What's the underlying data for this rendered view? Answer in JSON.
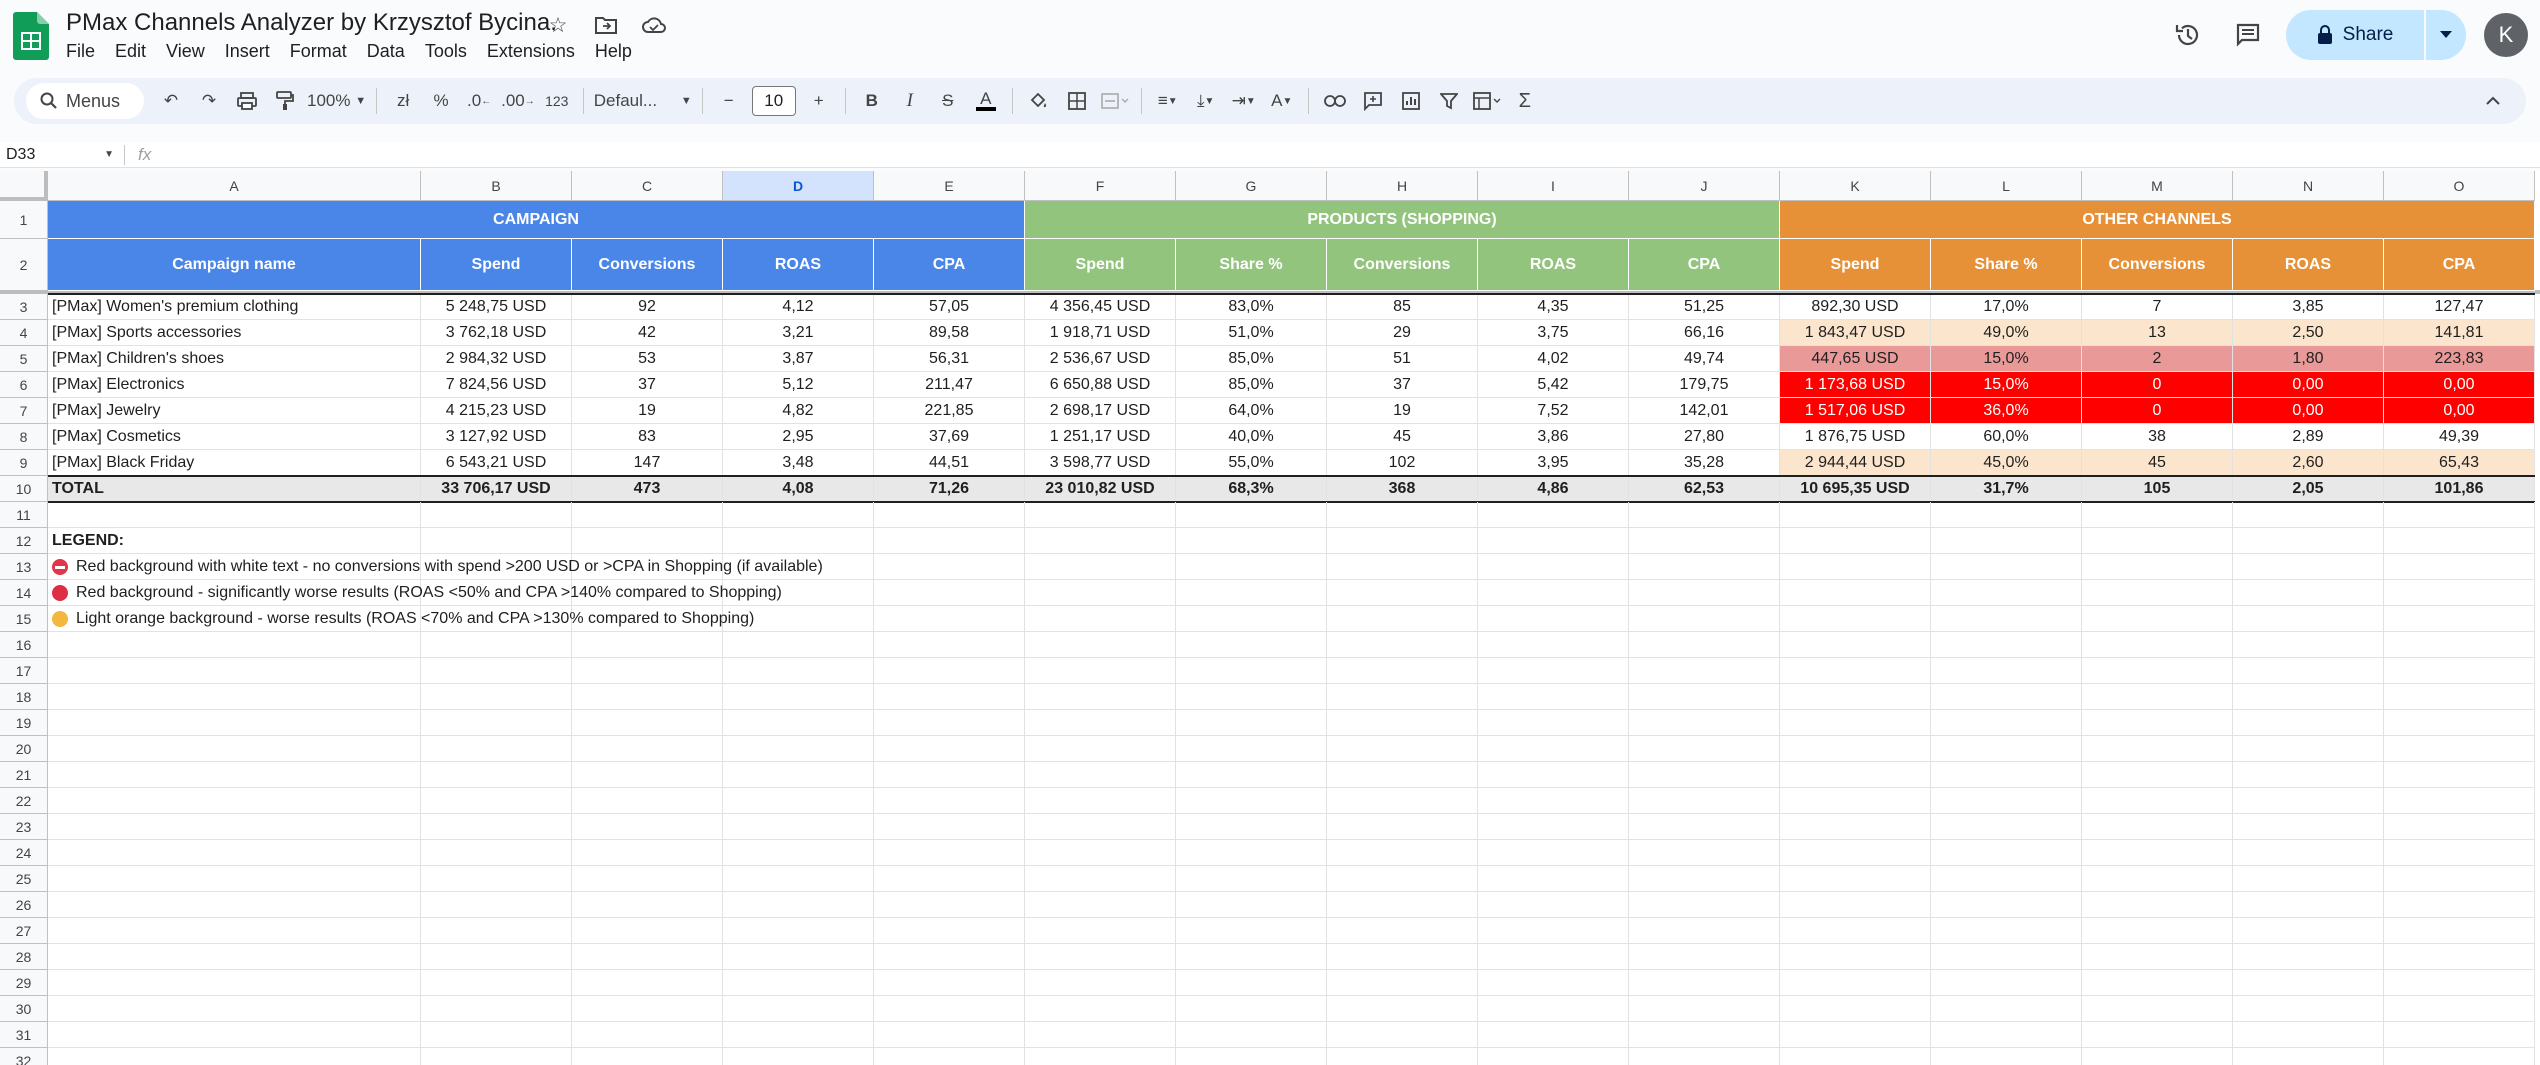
{
  "app": {
    "doc_title": "PMax Channels Analyzer by Krzysztof Bycina.",
    "menus": [
      "File",
      "Edit",
      "View",
      "Insert",
      "Format",
      "Data",
      "Tools",
      "Extensions",
      "Help"
    ],
    "share_label": "Share",
    "avatar_letter": "K"
  },
  "toolbar": {
    "search_label": "Menus",
    "zoom": "100%",
    "currency": "zł",
    "percent": "%",
    "dec_decrease": ".0",
    "dec_increase": ".00",
    "number_format": "123",
    "font": "Defaul...",
    "font_size": "10"
  },
  "formula_bar": {
    "cell_ref": "D33",
    "fx": "fx",
    "value": ""
  },
  "columns": [
    "A",
    "B",
    "C",
    "D",
    "E",
    "F",
    "G",
    "H",
    "I",
    "J",
    "K",
    "L",
    "M",
    "N",
    "O"
  ],
  "selected_column": "D",
  "rows_numbers": [
    "1",
    "2",
    "3",
    "4",
    "5",
    "6",
    "7",
    "8",
    "9",
    "10",
    "11",
    "12",
    "13",
    "14",
    "15",
    "16",
    "17",
    "18",
    "19",
    "20",
    "21",
    "22",
    "23",
    "24",
    "25",
    "26",
    "27",
    "28",
    "29",
    "30",
    "31",
    "32"
  ],
  "sections": {
    "campaign": "CAMPAIGN",
    "products": "PRODUCTS (SHOPPING)",
    "other": "OTHER CHANNELS"
  },
  "headers": [
    "Campaign name",
    "Spend",
    "Conversions",
    "ROAS",
    "CPA",
    "Spend",
    "Share %",
    "Conversions",
    "ROAS",
    "CPA",
    "Spend",
    "Share %",
    "Conversions",
    "ROAS",
    "CPA"
  ],
  "colors": {
    "campaign_bg": "#4a86e8",
    "products_bg": "#93c47d",
    "other_bg": "#e69138",
    "light_orange": "#fce5cd",
    "red_soft": "#ea9999",
    "red_strong": "#ff0000",
    "total_bg": "#e8e8e8"
  },
  "data_rows": [
    {
      "cells": [
        "[PMax] Women's premium clothing",
        "5 248,75 USD",
        "92",
        "4,12",
        "57,05",
        "4 356,45 USD",
        "83,0%",
        "85",
        "4,35",
        "51,25",
        "892,30 USD",
        "17,0%",
        "7",
        "3,85",
        "127,47"
      ],
      "other_style": "none"
    },
    {
      "cells": [
        "[PMax] Sports accessories",
        "3 762,18 USD",
        "42",
        "3,21",
        "89,58",
        "1 918,71 USD",
        "51,0%",
        "29",
        "3,75",
        "66,16",
        "1 843,47 USD",
        "49,0%",
        "13",
        "2,50",
        "141,81"
      ],
      "other_style": "light"
    },
    {
      "cells": [
        "[PMax] Children's shoes",
        "2 984,32 USD",
        "53",
        "3,87",
        "56,31",
        "2 536,67 USD",
        "85,0%",
        "51",
        "4,02",
        "49,74",
        "447,65 USD",
        "15,0%",
        "2",
        "1,80",
        "223,83"
      ],
      "other_style": "red"
    },
    {
      "cells": [
        "[PMax] Electronics",
        "7 824,56 USD",
        "37",
        "5,12",
        "211,47",
        "6 650,88 USD",
        "85,0%",
        "37",
        "5,42",
        "179,75",
        "1 173,68 USD",
        "15,0%",
        "0",
        "0,00",
        "0,00"
      ],
      "other_style": "strong"
    },
    {
      "cells": [
        "[PMax] Jewelry",
        "4 215,23 USD",
        "19",
        "4,82",
        "221,85",
        "2 698,17 USD",
        "64,0%",
        "19",
        "7,52",
        "142,01",
        "1 517,06 USD",
        "36,0%",
        "0",
        "0,00",
        "0,00"
      ],
      "other_style": "strong"
    },
    {
      "cells": [
        "[PMax] Cosmetics",
        "3 127,92 USD",
        "83",
        "2,95",
        "37,69",
        "1 251,17 USD",
        "40,0%",
        "45",
        "3,86",
        "27,80",
        "1 876,75 USD",
        "60,0%",
        "38",
        "2,89",
        "49,39"
      ],
      "other_style": "none"
    },
    {
      "cells": [
        "[PMax] Black Friday",
        "6 543,21 USD",
        "147",
        "3,48",
        "44,51",
        "3 598,77 USD",
        "55,0%",
        "102",
        "3,95",
        "35,28",
        "2 944,44 USD",
        "45,0%",
        "45",
        "2,60",
        "65,43"
      ],
      "other_style": "light"
    }
  ],
  "total_row": [
    "TOTAL",
    "33 706,17 USD",
    "473",
    "4,08",
    "71,26",
    "23 010,82 USD",
    "68,3%",
    "368",
    "4,86",
    "62,53",
    "10 695,35 USD",
    "31,7%",
    "105",
    "2,05",
    "101,86"
  ],
  "legend": {
    "title": "LEGEND:",
    "items": [
      {
        "icon": "no-entry-icon",
        "color": "#e0354b",
        "text": "Red background with white text - no conversions with spend >200 USD or >CPA in Shopping (if available)"
      },
      {
        "icon": "red-circle-icon",
        "color": "#dd2e44",
        "text": "Red background - significantly worse results (ROAS <50% and CPA >140% compared to Shopping)"
      },
      {
        "icon": "orange-circle-icon",
        "color": "#f4b63f",
        "text": "Light orange background - worse results (ROAS <70% and CPA >130% compared to Shopping)"
      }
    ]
  }
}
